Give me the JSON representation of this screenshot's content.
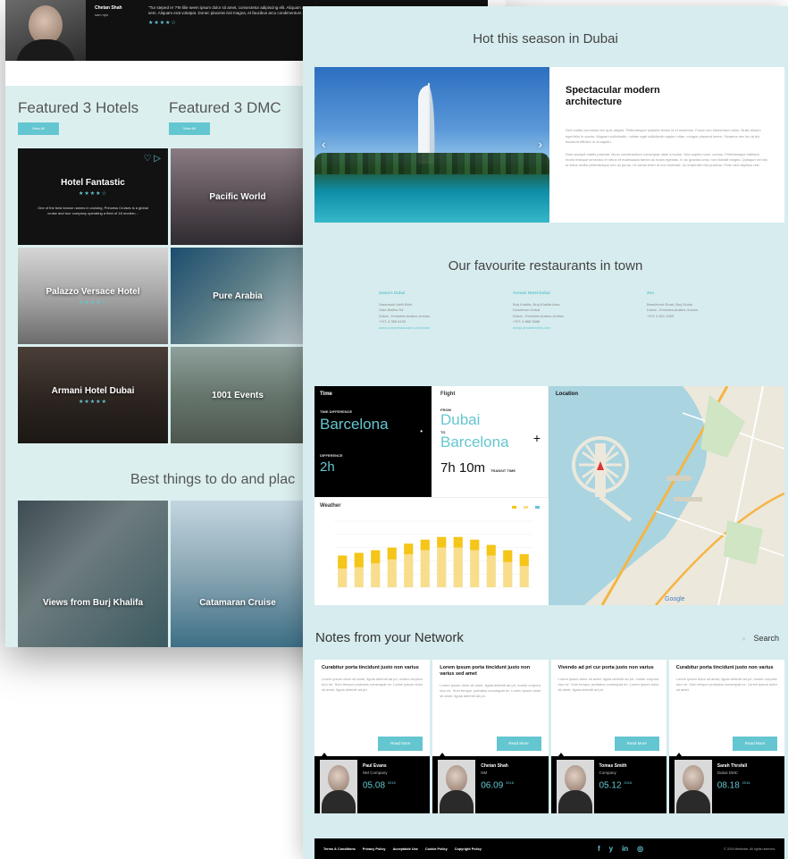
{
  "back": {
    "testimonial": {
      "name": "Chetan Shah",
      "role": "sam ripe",
      "quote": "\"Tur steped er ?Te lilie seem ipsum dolor sit amet, consectetur adipiscing elit. Aliquam at porttitor sem. Aliquam erat volutpat. Donec placerat nisl magna, et faucibus arcu condimentum sed\"",
      "stars": "★★★★☆"
    },
    "featured_hotels": {
      "title": "Featured  3 Hotels",
      "button": "View All"
    },
    "featured_dmc": {
      "title": "Featured  3 DMC",
      "button": "View All"
    },
    "tiles": [
      {
        "name": "Hotel Fantastic",
        "stars": "★★★★☆",
        "desc": "One of the best known names in cruising, Princess Cruises is a global cruise and tour company operating a fleet of 18 modern...",
        "icons": "♡ ▷"
      },
      {
        "name": "Pacific World",
        "stars": "",
        "desc": "",
        "icons": ""
      },
      {
        "name": "Palazzo Versace Hotel",
        "stars": "★★★★☆",
        "desc": "",
        "icons": ""
      },
      {
        "name": "Pure Arabia",
        "stars": "",
        "desc": "",
        "icons": ""
      },
      {
        "name": "Armani Hotel Dubai",
        "stars": "★★★★★",
        "desc": "",
        "icons": ""
      },
      {
        "name": "1001 Events",
        "stars": "",
        "desc": "",
        "icons": ""
      }
    ],
    "best_title": "Best things to do and plac",
    "best_tiles": [
      {
        "name": "Views from Burj Khalifa"
      },
      {
        "name": "Catamaran Cruise"
      }
    ]
  },
  "front": {
    "hot_title": "Hot this season in Dubai",
    "hot_card": {
      "heading": "Spectacular modern architecture",
      "p1": "Sed mattis commodo leo quis aliquet. Pellentesque sodales lectus id et maximus. Fusce nec elementum dolor. Nulla dictum eget felis in auctor. Aliquam sollicitudin, nullam eget sollicitudin sapien vitae, congue placerat lorem. Vivamus nec leo at dui tincidunt efficitur ut at sapien.",
      "p2": "Duis suscipit mattis pulvinar. Nunc condimentum consequat diam a luctus. Sed sapien nunc, cursus. Pellentesque habitant morbi tristique senectus et netus et malesuada fames ac turpis egestas. In ac gravida urna, non blandit magna. Quisque vel nisi ut tellus mollis pellentesque nec ac purus. Ut varius enim ut orci molestie, eu imperdiet nisl pulvinar. Proin sed dapibus nisl.",
      "prev": "‹",
      "next": "›"
    },
    "restaurants_title": "Our favourite restaurants in town",
    "restaurants": [
      {
        "name": "Zuma's Dubai",
        "lines": [
          "Saramouk Atelli Bldh",
          "Gate Balthu Rd",
          "Dubai - Emirates Arabes Unidos",
          "+971 4 356 6100"
        ],
        "link": "www.zumarestaurant.com/dubai"
      },
      {
        "name": "Armani Hotel Dubai",
        "lines": [
          "Burj Khalifa, Burj Khalifa Area",
          "Downtown Dubai",
          "Dubai - Emirates Arabes Unidos",
          "+971 4 888 3888"
        ],
        "link": "dubai.armanihotels.com"
      },
      {
        "name": "Zen",
        "lines": [
          "Beachfront Road, Burj Dubai",
          "Dubai - Emirates Arabes Unidos",
          "+971 4 601 2000"
        ],
        "link": ""
      }
    ],
    "time": {
      "label": "Time",
      "sub": "TIME DIFFERENCE",
      "city": "Barcelona",
      "sub2": "DIFFERENCE",
      "diff": "2h"
    },
    "flight": {
      "label": "Flight",
      "from_label": "FROM",
      "from": "Dubai",
      "to_label": "TO",
      "to": "Barcelona",
      "time": "7h 10m",
      "time_label": "TRANSIT TIME"
    },
    "location": {
      "label": "Location",
      "credit": "Google"
    },
    "weather": {
      "label": "Weather"
    },
    "notes_title": "Notes from your Network",
    "search_label": "Search",
    "notes": [
      {
        "title": "Curabitur porta tincidunt justo non varius",
        "text": "Lorem ipsum dolor sit amet, ligula deleniti ad pri, noster corpora duo ne. Sum tempor probatus consequat ex. Lorem ipsum dolor sit amet, ligula deleniti ad pri.",
        "button": "Read More",
        "name": "Paul Evans",
        "company": "NM Company",
        "date": "05.08",
        "year": "2016"
      },
      {
        "title": "Lorem ipsum porta tincidunt justo non varius sed amet",
        "text": "Lorem ipsum dolor sit amet, ligula deleniti ad pri, noster corpora duo ne. Sum tempor probatus consequat ex. Lorem ipsum dolor sit amet, ligula deleniti ad pri.",
        "button": "Read More",
        "name": "Chetan Shah",
        "company": "NM",
        "date": "06.09",
        "year": "2016"
      },
      {
        "title": "Vivendo ad pri cur porta justo non varius",
        "text": "Lorem ipsum dolor sit amet, ligula deleniti ad pri, noster corpora duo ne. Sum tempor probatus consequat ex. Lorem ipsum dolor sit amet, ligula deleniti ad pri.",
        "button": "Read More",
        "name": "Tomas Smith",
        "company": "Company",
        "date": "05.12",
        "year": "2016"
      },
      {
        "title": "Curabitur porta tincidunt justo non varius",
        "text": "Lorem ipsum dolor sit amet, ligula deleniti ad pri, noster corpora duo ne. Sum tempor probatus consequat ex. Lorem ipsum dolor sit amet.",
        "button": "Read More",
        "name": "Sarah Thrsfall",
        "company": "Dubai DMC",
        "date": "08.18",
        "year": "2016"
      }
    ],
    "footer": {
      "links": [
        "Terms & Conditions",
        "Privacy Policy",
        "Acceptable Use",
        "Cookie Policy",
        "Copyright Policy"
      ],
      "social": [
        "f",
        "y",
        "in",
        "◎"
      ],
      "copyright": "© 2016 Meetwise. All rights reserved."
    }
  },
  "colors": {
    "accent": "#64c6d0",
    "bar_dark": "#f5c518",
    "bar_light": "#f8dd8c",
    "line": "#64c6d0"
  },
  "chart_data": {
    "type": "bar",
    "title": "Weather",
    "series": [
      {
        "values": [
          24,
          26,
          28,
          30,
          33,
          36,
          38,
          38,
          36,
          32,
          28,
          25
        ]
      },
      {
        "values": [
          14,
          15,
          18,
          21,
          25,
          28,
          30,
          30,
          28,
          24,
          19,
          16
        ]
      }
    ],
    "legend_placement": "top-right",
    "ylim": [
      0,
      50
    ]
  }
}
